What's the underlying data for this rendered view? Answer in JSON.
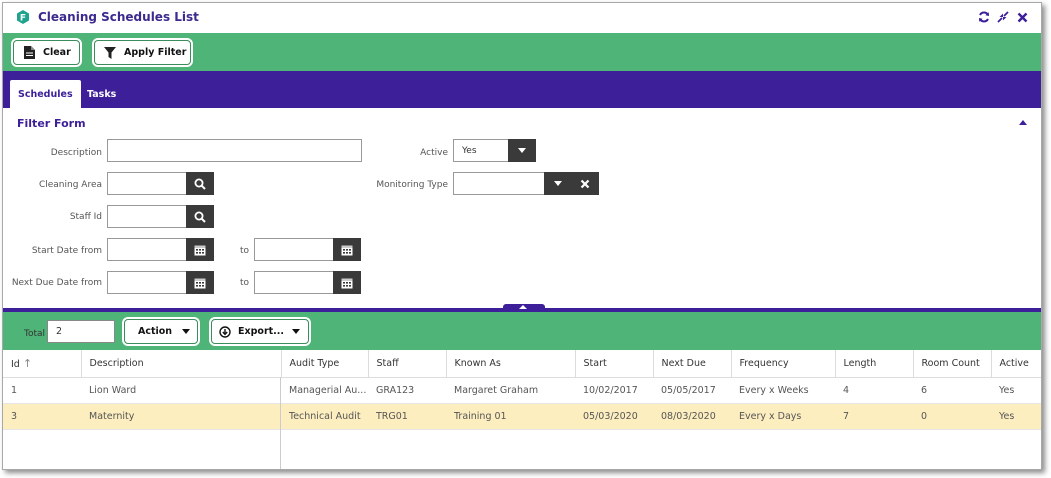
{
  "window": {
    "title": "Cleaning Schedules List"
  },
  "toolbar": {
    "clear_label": "Clear",
    "apply_filter_label": "Apply Filter"
  },
  "tabs": [
    {
      "label": "Schedules",
      "active": true
    },
    {
      "label": "Tasks",
      "active": false
    }
  ],
  "filter_form": {
    "title": "Filter Form",
    "description_label": "Description",
    "description_value": "",
    "cleaning_area_label": "Cleaning Area",
    "cleaning_area_value": "",
    "staff_id_label": "Staff Id",
    "staff_id_value": "",
    "start_date_from_label": "Start Date from",
    "start_date_from_value": "",
    "start_date_to_label": "to",
    "start_date_to_value": "",
    "next_due_from_label": "Next Due Date from",
    "next_due_from_value": "",
    "next_due_to_label": "to",
    "next_due_to_value": "",
    "active_label": "Active",
    "active_value": "Yes",
    "monitoring_type_label": "Monitoring Type",
    "monitoring_type_value": ""
  },
  "grid_toolbar": {
    "total_label": "Total",
    "total_value": "2",
    "action_label": "Action",
    "export_label": "Export..."
  },
  "table": {
    "columns": [
      "Id",
      "Description",
      "Audit Type",
      "Staff",
      "Known As",
      "Start",
      "Next Due",
      "Frequency",
      "Length",
      "Room Count",
      "Active"
    ],
    "rows": [
      [
        "1",
        "Lion Ward",
        "Managerial Au...",
        "GRA123",
        "Margaret Graham",
        "10/02/2017",
        "05/05/2017",
        "Every x Weeks",
        "4",
        "6",
        "Yes"
      ],
      [
        "3",
        "Maternity",
        "Technical Audit",
        "TRG01",
        "Training 01",
        "05/03/2020",
        "08/03/2020",
        "Every x Days",
        "7",
        "0",
        "Yes"
      ]
    ]
  },
  "colors": {
    "green": "#4fb477",
    "purple": "#3d1f99",
    "selected_row": "#fdeec0",
    "dark_button": "#3a3a3a"
  }
}
